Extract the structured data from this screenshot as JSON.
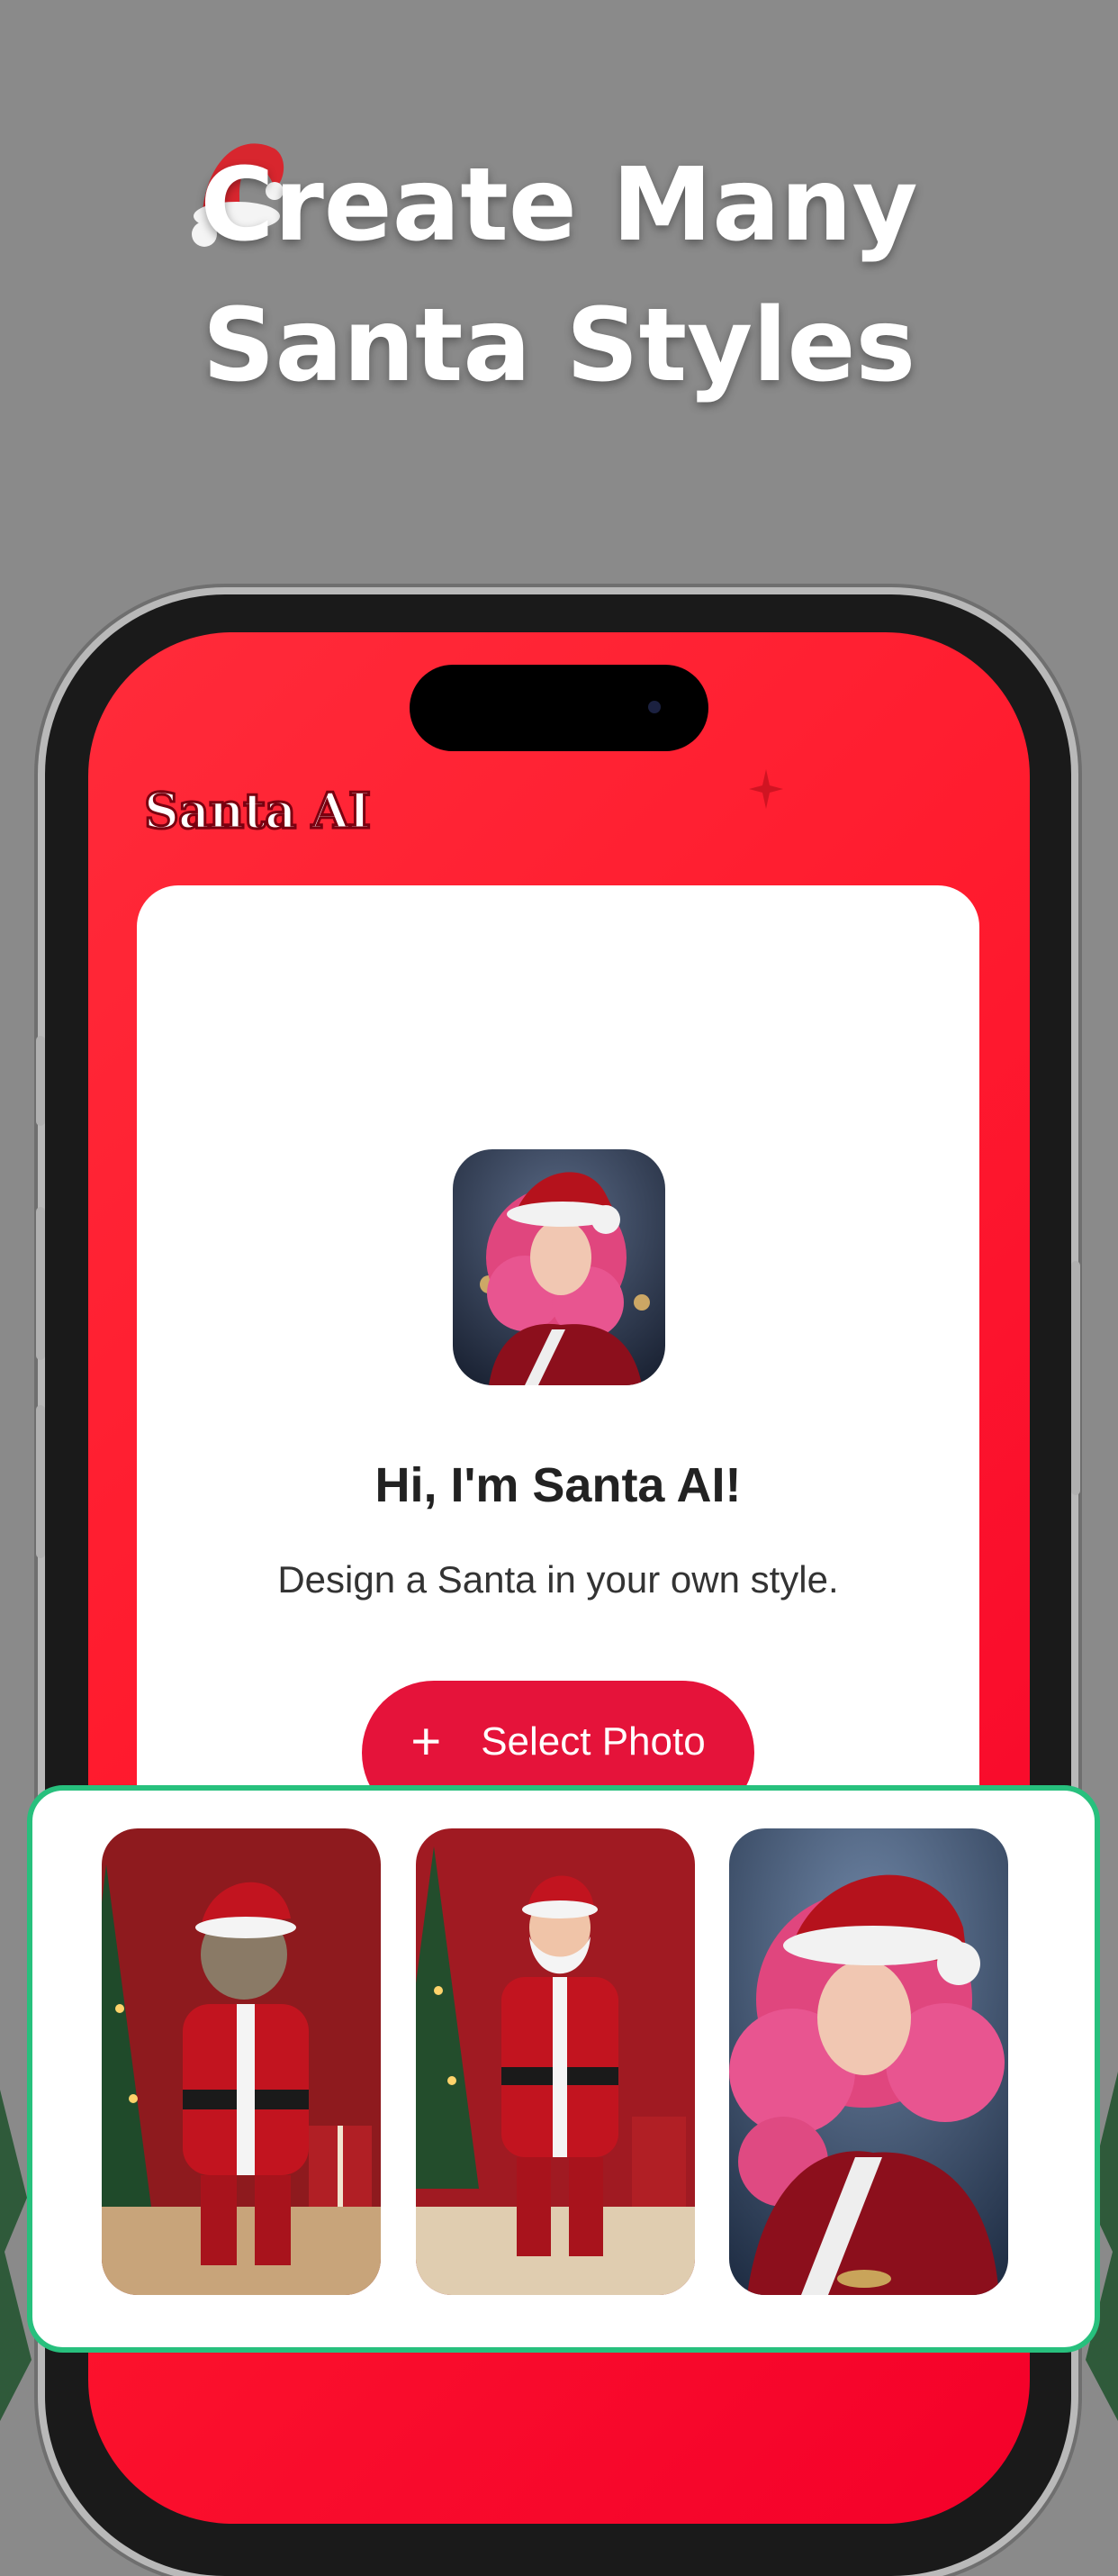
{
  "headline": {
    "line1": "Create Many",
    "line2": "Santa Styles"
  },
  "app": {
    "brand": "Santa AI",
    "greeting": "Hi, I'm Santa AI!",
    "subtitle": "Design a Santa in your own style.",
    "select_button": {
      "icon": "+",
      "label": "Select Photo"
    }
  },
  "gallery": [
    {
      "subject": "cat in santa suit"
    },
    {
      "subject": "santa claus"
    },
    {
      "subject": "woman in santa hat"
    }
  ],
  "colors": {
    "background": "#8a8a8a",
    "screen_red": "#ff1b2e",
    "button_red": "#e5133a",
    "gallery_border": "#27c07d"
  },
  "icons": [
    "santa-hat-icon",
    "plus-icon",
    "sparkle-icon"
  ]
}
